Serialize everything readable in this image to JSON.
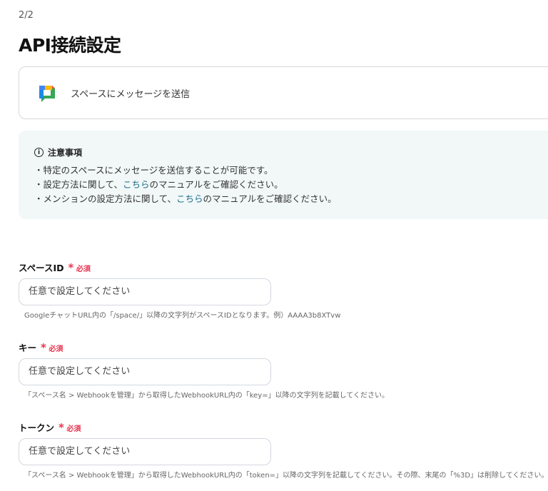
{
  "step": "2/2",
  "title": "API接続設定",
  "action": {
    "label": "スペースにメッセージを送信",
    "icon": "google-chat-icon"
  },
  "notice": {
    "heading": "注意事項",
    "line1": "・特定のスペースにメッセージを送信することが可能です。",
    "line2_pre": "・設定方法に関して、",
    "line2_link": "こちら",
    "line2_post": "のマニュアルをご確認ください。",
    "line3_pre": "・メンションの設定方法に関して、",
    "line3_link": "こちら",
    "line3_post": "のマニュアルをご確認ください。"
  },
  "required_label": "必須",
  "fields": [
    {
      "label": "スペースID",
      "placeholder": "任意で設定してください",
      "help": "GoogleチャットURL内の「/space/」以降の文字列がスペースIDとなります。例）AAAA3b8XTvw"
    },
    {
      "label": "キー",
      "placeholder": "任意で設定してください",
      "help": "「スペース名 > Webhookを管理」から取得したWebhookURL内の「key=」以降の文字列を記載してください。"
    },
    {
      "label": "トークン",
      "placeholder": "任意で設定してください",
      "help": "「スペース名 > Webhookを管理」から取得したWebhookURL内の「token=」以降の文字列を記載してください。その際、末尾の「%3D」は削除してください。"
    }
  ]
}
